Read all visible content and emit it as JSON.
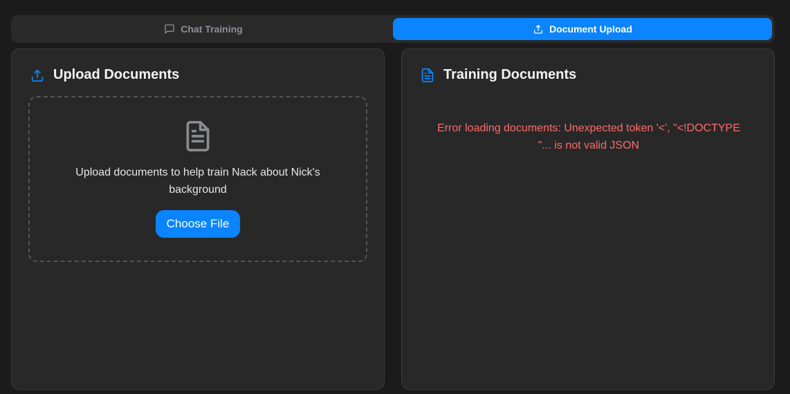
{
  "tabs": [
    {
      "label": "Chat Training",
      "icon": "chat-bubble-icon",
      "active": false
    },
    {
      "label": "Document Upload",
      "icon": "upload-icon",
      "active": true
    }
  ],
  "upload_panel": {
    "title": "Upload Documents",
    "icon": "upload-icon",
    "dropzone": {
      "icon": "document-icon",
      "text": "Upload documents to help train Nack about Nick's background",
      "button_label": "Choose File"
    }
  },
  "training_panel": {
    "title": "Training Documents",
    "icon": "document-icon",
    "error": "Error loading documents: Unexpected token '<', \"<!DOCTYPE \"... is not valid JSON"
  },
  "colors": {
    "accent": "#0a84ff",
    "background": "#1b1b1b",
    "panel": "#282828",
    "error": "#ff6b6b"
  }
}
